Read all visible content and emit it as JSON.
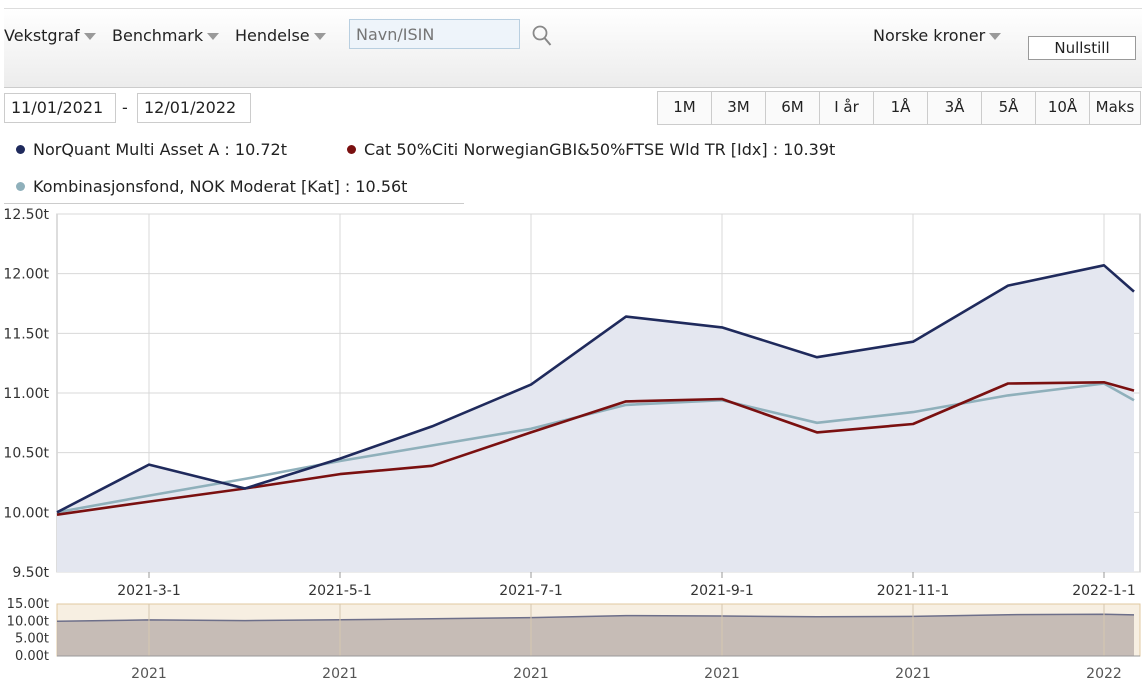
{
  "toolbar": {
    "growth_menu": "Vekstgraf",
    "benchmark_menu": "Benchmark",
    "event_menu": "Hendelse",
    "search_placeholder": "Navn/ISIN",
    "currency_menu": "Norske kroner",
    "reset_label": "Nullstill"
  },
  "dates": {
    "from": "11/01/2021",
    "separator": "-",
    "to": "12/01/2022"
  },
  "ranges": [
    "1M",
    "3M",
    "6M",
    "I år",
    "1Å",
    "3Å",
    "5Å",
    "10Å",
    "Maks"
  ],
  "legend": [
    {
      "label": "NorQuant Multi Asset A : 10.72t",
      "color": "#1f2a5c"
    },
    {
      "label": "Cat 50%Citi NorwegianGBI&50%FTSE Wld TR [Idx] : 10.39t",
      "color": "#7a1010"
    },
    {
      "label": "Kombinasjonsfond, NOK Moderat [Kat] : 10.56t",
      "color": "#8fb0bb"
    }
  ],
  "chart_data": [
    {
      "type": "line",
      "x": [
        "2021-1-1",
        "2021-3-1",
        "2021-4-1",
        "2021-5-1",
        "2021-6-1",
        "2021-7-1",
        "2021-8-1",
        "2021-9-1",
        "2021-10-1",
        "2021-11-1",
        "2021-12-1",
        "2022-1-1",
        "2022-1-20"
      ],
      "x_tick_labels": [
        "2021-3-1",
        "2021-5-1",
        "2021-7-1",
        "2021-9-1",
        "2021-11-1",
        "2022-1-1"
      ],
      "y_tick_labels": [
        "9.50t",
        "10.00t",
        "10.50t",
        "11.00t",
        "11.50t",
        "12.00t",
        "12.50t"
      ],
      "ylim": [
        9.5,
        12.5
      ],
      "grid": true,
      "series": [
        {
          "name": "NorQuant Multi Asset A",
          "color": "#1f2a5c",
          "values": [
            10.0,
            10.4,
            10.2,
            10.45,
            10.72,
            11.07,
            11.64,
            11.55,
            11.3,
            11.43,
            11.9,
            12.07,
            11.85
          ]
        },
        {
          "name": "Cat 50%Citi NorwegianGBI&50%FTSE Wld TR [Idx]",
          "color": "#7a1010",
          "values": [
            9.98,
            10.09,
            10.2,
            10.32,
            10.39,
            10.67,
            10.93,
            10.95,
            10.67,
            10.74,
            11.08,
            11.09,
            11.02
          ]
        },
        {
          "name": "Kombinasjonsfond, NOK Moderat [Kat]",
          "color": "#8fb0bb",
          "values": [
            10.0,
            10.14,
            10.28,
            10.43,
            10.56,
            10.7,
            10.9,
            10.94,
            10.75,
            10.84,
            10.98,
            11.08,
            10.94
          ]
        }
      ]
    },
    {
      "type": "area",
      "x_tick_labels": [
        "2021",
        "2021",
        "2021",
        "2021",
        "2021",
        "2022"
      ],
      "y_tick_labels": [
        "0.00t",
        "5.00t",
        "10.00t",
        "15.00t"
      ],
      "ylim": [
        0,
        15
      ],
      "values": [
        10.0,
        10.4,
        10.2,
        10.45,
        10.72,
        11.07,
        11.64,
        11.55,
        11.3,
        11.43,
        11.9,
        12.07,
        11.85
      ]
    }
  ]
}
